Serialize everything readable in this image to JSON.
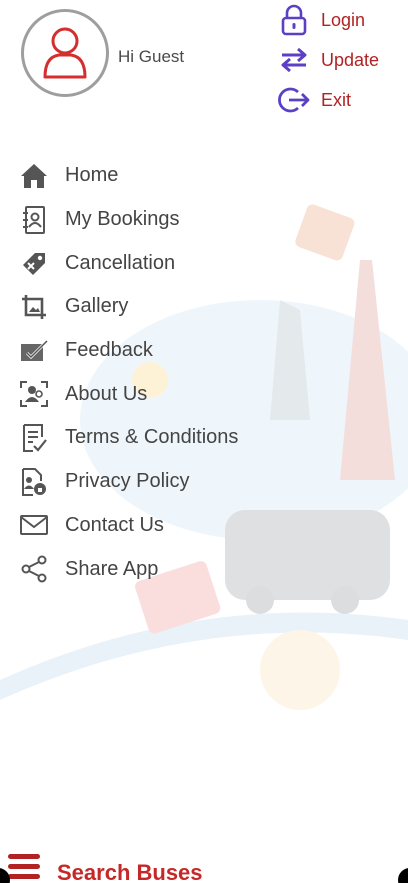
{
  "header": {
    "greeting": "Hi Guest",
    "avatar_icon": "user-avatar-icon"
  },
  "top_actions": [
    {
      "label": "Login",
      "icon": "lock-icon"
    },
    {
      "label": "Update",
      "icon": "swap-arrows-icon"
    },
    {
      "label": "Exit",
      "icon": "logout-icon"
    }
  ],
  "menu": {
    "items": [
      {
        "label": "Home",
        "icon": "home-icon"
      },
      {
        "label": "My Bookings",
        "icon": "address-book-icon"
      },
      {
        "label": "Cancellation",
        "icon": "cancel-ticket-icon"
      },
      {
        "label": "Gallery",
        "icon": "gallery-crop-icon"
      },
      {
        "label": "Feedback",
        "icon": "feedback-pen-icon"
      },
      {
        "label": "About Us",
        "icon": "about-person-icon"
      },
      {
        "label": "Terms & Conditions",
        "icon": "terms-checklist-icon"
      },
      {
        "label": "Privacy Policy",
        "icon": "privacy-document-icon"
      },
      {
        "label": "Contact Us",
        "icon": "envelope-icon"
      },
      {
        "label": "Share App",
        "icon": "share-icon"
      }
    ]
  },
  "bottom_bar": {
    "label": "Search Buses",
    "icon": "hamburger-menu-icon"
  },
  "colors": {
    "accent_red": "#b22222",
    "action_purple": "#5b3fc4",
    "menu_text": "#444444",
    "icon_grey": "#555555"
  }
}
